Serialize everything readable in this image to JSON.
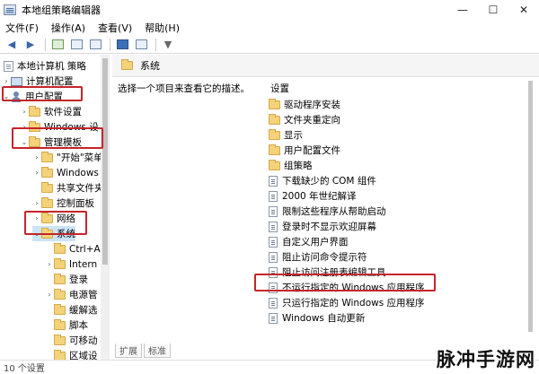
{
  "window": {
    "title": "本地组策略编辑器",
    "controls": [
      "—",
      "☐",
      "✕"
    ]
  },
  "menubar": [
    "文件(F)",
    "操作(A)",
    "查看(V)",
    "帮助(H)"
  ],
  "toolbar": {
    "icons": [
      "back-icon",
      "forward-icon",
      "folder-up-icon",
      "show-hide-tree-icon",
      "export-list-icon",
      "help-icon",
      "properties-icon",
      "filter-icon"
    ]
  },
  "tree": {
    "items": [
      {
        "label": "本地计算机 策略",
        "icon": "doc",
        "arrow": ""
      },
      {
        "label": "计算机配置",
        "icon": "pc",
        "arrow": "›"
      },
      {
        "label": "用户配置",
        "icon": "user",
        "arrow": "⌄"
      },
      {
        "label": "软件设置",
        "icon": "folder",
        "arrow": "›"
      },
      {
        "label": "Windows 设",
        "icon": "folder",
        "arrow": "›"
      },
      {
        "label": "管理模板",
        "icon": "folder",
        "arrow": "⌄"
      },
      {
        "label": "\"开始\"菜单",
        "icon": "folder",
        "arrow": "›"
      },
      {
        "label": "Windows",
        "icon": "folder",
        "arrow": "›"
      },
      {
        "label": "共享文件夹",
        "icon": "folder",
        "arrow": ""
      },
      {
        "label": "控制面板",
        "icon": "folder",
        "arrow": "›"
      },
      {
        "label": "网络",
        "icon": "folder",
        "arrow": "›"
      },
      {
        "label": "系统",
        "icon": "folder",
        "arrow": "⌄"
      },
      {
        "label": "Ctrl+A",
        "icon": "folder",
        "arrow": ""
      },
      {
        "label": "Intern",
        "icon": "folder",
        "arrow": "›"
      },
      {
        "label": "登录",
        "icon": "folder",
        "arrow": ""
      },
      {
        "label": "电源管",
        "icon": "folder",
        "arrow": "›"
      },
      {
        "label": "缓解选",
        "icon": "folder",
        "arrow": ""
      },
      {
        "label": "脚本",
        "icon": "folder",
        "arrow": ""
      },
      {
        "label": "可移动",
        "icon": "folder",
        "arrow": ""
      },
      {
        "label": "区域设",
        "icon": "folder",
        "arrow": ""
      }
    ]
  },
  "main": {
    "header": "系统",
    "description": "选择一个项目来查看它的描述。",
    "column_header": "设置",
    "folders": [
      "驱动程序安装",
      "文件夹重定向",
      "显示",
      "用户配置文件",
      "组策略"
    ],
    "settings": [
      "下载缺少的 COM 组件",
      "2000 年世纪解译",
      "限制这些程序从帮助启动",
      "登录时不显示欢迎屏幕",
      "自定义用户界面",
      "阻止访问命令提示符",
      "阻止访问注册表编辑工具",
      "不运行指定的 Windows 应用程序",
      "只运行指定的 Windows 应用程序",
      "Windows 自动更新"
    ]
  },
  "tabs": [
    "扩展",
    "标准"
  ],
  "status": "10 个设置",
  "watermark": "脉冲手游网",
  "colors": {
    "highlight_box": "#c4252a",
    "folder": "#f3d27a"
  }
}
